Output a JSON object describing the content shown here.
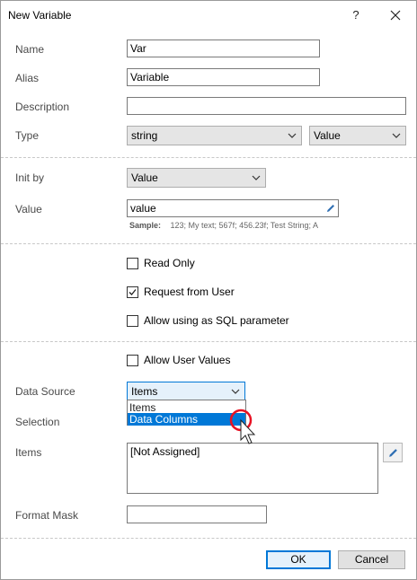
{
  "window": {
    "title": "New Variable",
    "help_label": "?"
  },
  "fields": {
    "name": {
      "label": "Name",
      "value": "Var"
    },
    "alias": {
      "label": "Alias",
      "value": "Variable"
    },
    "description": {
      "label": "Description",
      "value": ""
    },
    "type": {
      "label": "Type",
      "value": "string",
      "kind": "Value"
    },
    "init_by": {
      "label": "Init by",
      "value": "Value"
    },
    "value": {
      "label": "Value",
      "value": "value",
      "sample_label": "Sample:",
      "sample_text": "123; My text; 567f; 456.23f; Test String; A"
    }
  },
  "options": {
    "read_only": {
      "label": "Read Only",
      "checked": false
    },
    "request_from_user": {
      "label": "Request from User",
      "checked": true
    },
    "allow_sql": {
      "label": "Allow using as SQL parameter",
      "checked": false
    },
    "allow_user_values": {
      "label": "Allow User Values",
      "checked": false
    }
  },
  "data_source": {
    "label": "Data Source",
    "value": "Items",
    "dropdown_options": [
      "Items",
      "Data Columns"
    ],
    "highlighted_option": "Data Columns"
  },
  "selection": {
    "label": "Selection"
  },
  "items": {
    "label": "Items",
    "value": "[Not Assigned]"
  },
  "format_mask": {
    "label": "Format Mask",
    "value": ""
  },
  "buttons": {
    "ok": "OK",
    "cancel": "Cancel"
  },
  "colors": {
    "accent": "#0078d7",
    "cursor_ring": "#e81123"
  },
  "icons": [
    "close-icon",
    "chevron-down-icon",
    "pencil-icon",
    "checkmark-icon",
    "mouse-pointer-icon"
  ]
}
